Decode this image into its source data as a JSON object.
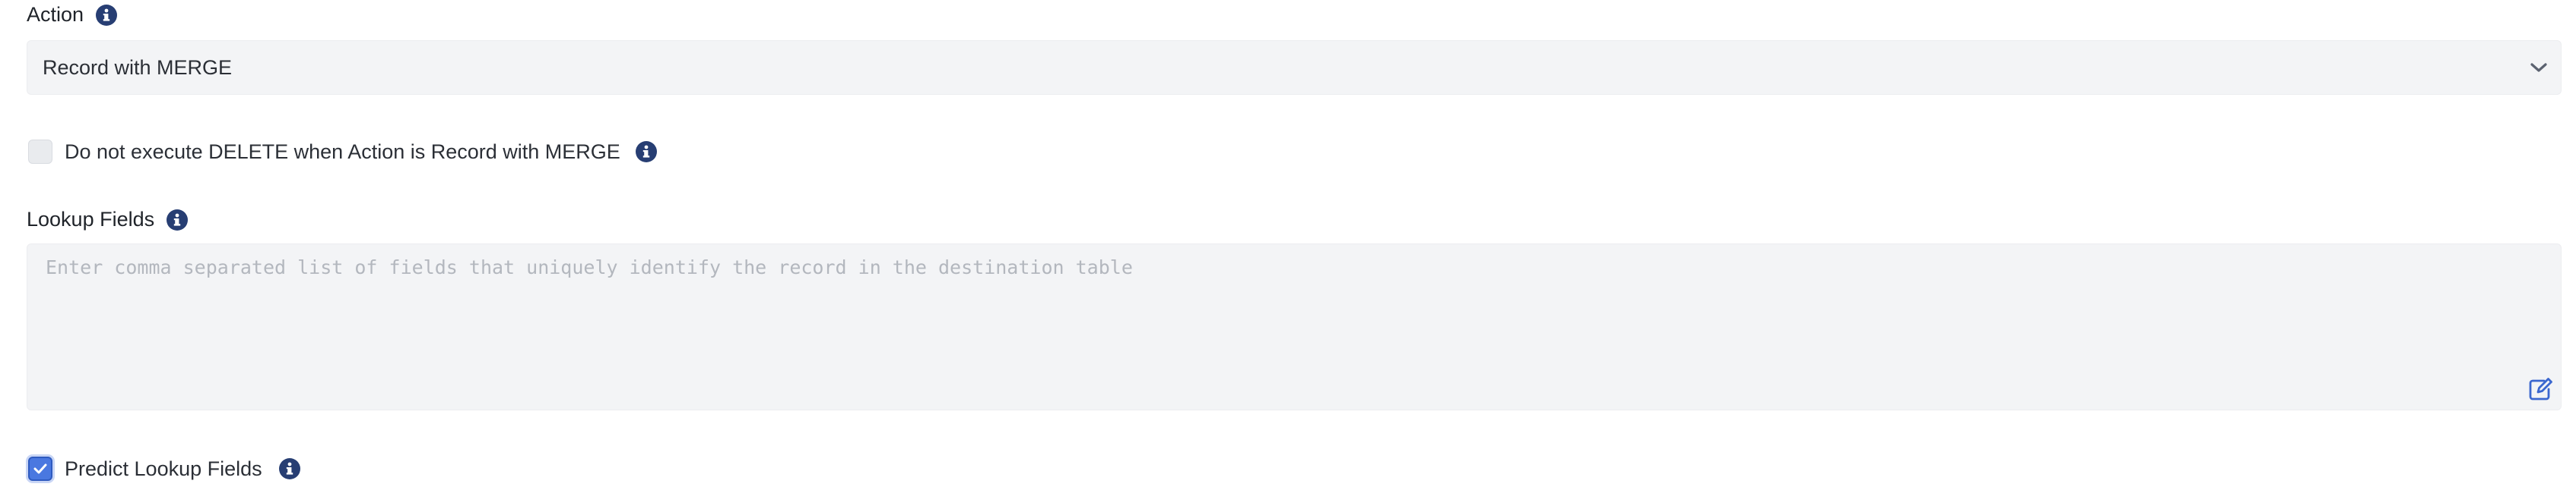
{
  "action": {
    "label": "Action",
    "info_icon": "info-icon",
    "selected_value": "Record with MERGE",
    "dropdown_icon": "chevron-down-icon"
  },
  "skip_delete": {
    "label": "Do not execute DELETE when Action is Record with MERGE",
    "checked": false,
    "info_icon": "info-icon"
  },
  "lookup_fields": {
    "label": "Lookup Fields",
    "info_icon": "info-icon",
    "value": "",
    "placeholder": "Enter comma separated list of fields that uniquely identify the record in the destination table",
    "edit_icon": "edit-icon"
  },
  "predict_lookup": {
    "label": "Predict Lookup Fields",
    "checked": true,
    "info_icon": "info-icon"
  },
  "colors": {
    "info_icon_bg": "#273e73",
    "input_bg": "#f3f4f6",
    "checkbox_checked": "#4a78e0",
    "placeholder_text": "#b3b7be"
  }
}
